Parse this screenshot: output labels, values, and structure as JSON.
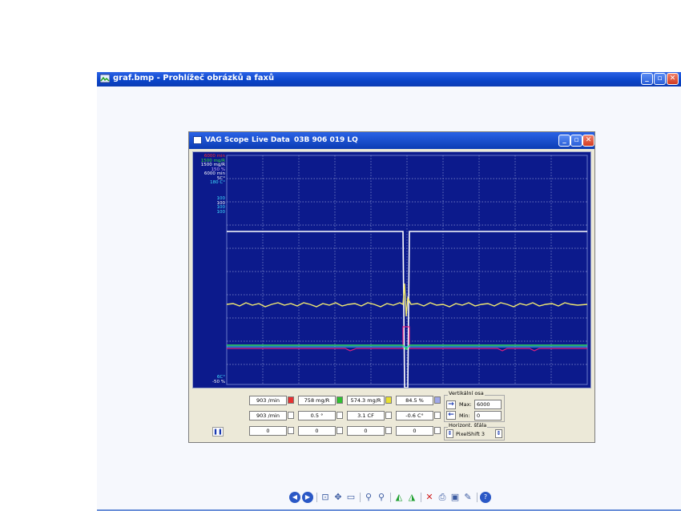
{
  "viewer": {
    "title": "graf.bmp - Prohlížeč obrázků a faxů",
    "toolbar_icons": [
      "previous-icon",
      "next-icon",
      "best-fit-icon",
      "actual-size-icon",
      "slideshow-icon",
      "zoom-in-icon",
      "zoom-out-icon",
      "rotate-clockwise-icon",
      "rotate-counterclockwise-icon",
      "delete-icon",
      "print-icon",
      "save-icon",
      "edit-icon",
      "help-icon"
    ]
  },
  "scope": {
    "app_name": "VAG Scope",
    "mode": "Live Data",
    "part_number": "03B 906 019 LQ",
    "legend_top": [
      {
        "text": "6000 min",
        "color": "#ff3030"
      },
      {
        "text": "1500 mg/R",
        "color": "#30e030"
      },
      {
        "text": "1500 mg/R",
        "color": "#ffffff"
      },
      {
        "text": "150 %",
        "color": "#c0a0ff"
      },
      {
        "text": "6000 min",
        "color": "#ffffff"
      },
      {
        "text": "5C°",
        "color": "#ffffff"
      },
      {
        "text": "180 C°",
        "color": "#40e0ff"
      }
    ],
    "legend_mid": [
      {
        "text": "100",
        "color": "#40e0ff"
      },
      {
        "text": "100",
        "color": "#ffffff"
      },
      {
        "text": "100",
        "color": "#40e0ff"
      },
      {
        "text": "100",
        "color": "#40e0ff"
      }
    ],
    "legend_bottom": [
      {
        "text": "6C°",
        "color": "#40e0ff"
      },
      {
        "text": "-50 %",
        "color": "#ffffff"
      }
    ],
    "channels_row1": [
      {
        "value": "903 /min",
        "color": "#e83030"
      },
      {
        "value": "758 mg/R",
        "color": "#30c030"
      },
      {
        "value": "574.3 mg/R",
        "color": "#e8e030"
      },
      {
        "value": "84.5 %",
        "color": "#a0a8e8"
      }
    ],
    "channels_row2": [
      "903 /min",
      "0.5 °",
      "3.1 CF",
      "-0.6 C°"
    ],
    "channels_row3": [
      "0",
      "0",
      "0",
      "0"
    ],
    "vertical_scale": {
      "title": "Vertikální osa",
      "max_label": "Max:",
      "max_value": "6000",
      "min_label": "Min:",
      "min_value": "0"
    },
    "horizontal_scale": {
      "title": "Horizont. šťála",
      "value": "PixelShift 3"
    }
  }
}
